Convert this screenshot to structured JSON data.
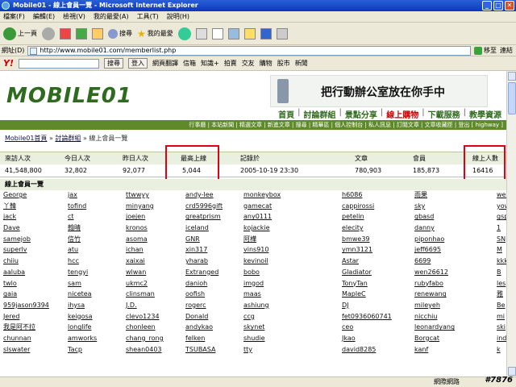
{
  "window": {
    "title": "Mobile01 - 線上會員一覽 - Microsoft Internet Explorer"
  },
  "menu": [
    "檔案(F)",
    "編輯(E)",
    "檢視(V)",
    "我的最愛(A)",
    "工具(T)",
    "說明(H)"
  ],
  "toolbar": {
    "back": "上一頁",
    "search": "搜尋",
    "favorites": "我的最愛"
  },
  "address": {
    "label": "網址(D)",
    "url": "http://www.mobile01.com/memberlist.php",
    "go": "移至",
    "links": "連結"
  },
  "yahoo_bar": {
    "logo": "Y!",
    "search_btn": "搜尋",
    "login_btn": "登入",
    "items": [
      "網頁翻譯",
      "信箱",
      "知識+",
      "拍賣",
      "交友",
      "購物",
      "股市",
      "新聞"
    ]
  },
  "site": {
    "logo": "MOBILE01",
    "banner_text": "把行動辦公室放在你手中",
    "nav": [
      "首頁",
      "討論群組",
      "景點分享",
      "線上購物",
      "下載服務",
      "教學資源"
    ],
    "active_nav": "線上購物",
    "subnav": "行事曆 | 本站新聞 | 精選文章 | 新進文章 | 搜尋 | 精華區 | 個人控制台 | 私人訊息 | 訂閱文章 | 文章收藏匣 | 登出 [ highway ]",
    "breadcrumb": [
      "Mobile01首頁",
      "討論群組",
      "線上會員一覽"
    ]
  },
  "stats": {
    "headers": [
      "來訪人次",
      "今日人次",
      "昨日人次",
      "最高上線",
      "記錄於",
      "文章",
      "會員",
      "線上人數"
    ],
    "values": [
      "41,548,800",
      "32,802",
      "92,077",
      "5,044",
      "2005-10-19 23:30",
      "780,903",
      "185,873",
      "16416"
    ]
  },
  "section_title": "線上會員一覽",
  "members": [
    [
      "George",
      "jax",
      "ttwwyy",
      "andy-lee",
      "monkeybox",
      "h6086",
      "雨果",
      "wer"
    ],
    [
      "丫韓",
      "tofind",
      "minyang",
      "crd5996gift",
      "gamecat",
      "cappirossi",
      "sky",
      "yow"
    ],
    [
      "jack",
      "ct",
      "joejen",
      "greatprism",
      "any0111",
      "petelin",
      "gbasd",
      "gsp"
    ],
    [
      "Dave",
      "翰晴",
      "kronos",
      "iceland",
      "kojackie",
      "elecity",
      "danny",
      "1"
    ],
    [
      "samejob",
      "信竹",
      "asoma",
      "GNR",
      "阿樺",
      "bmwe39",
      "piponhao",
      "SN"
    ],
    [
      "superlv",
      "atu",
      "ichan",
      "xin317",
      "vins910",
      "ymn3121",
      "jeff6695",
      "M"
    ],
    [
      "chiiu",
      "hcc",
      "xaixai",
      "yharab",
      "kevinoil",
      "Astar",
      "6699",
      "kkk"
    ],
    [
      "aaluba",
      "tengyi",
      "wlwan",
      "Extranged",
      "bobo",
      "Gladiator",
      "wen26612",
      "B"
    ],
    [
      "twlo",
      "sam",
      "ukmc2",
      "danioh",
      "imgod",
      "TonyTan",
      "rubyfabo",
      "les"
    ],
    [
      "gaia",
      "nicetea",
      "clinsman",
      "oofish",
      "maas",
      "MapleC",
      "renewang",
      "雅"
    ],
    [
      "959jason9394",
      "ihysa",
      "J.D.",
      "rogerc",
      "ashiung",
      "DJ",
      "mileyeh",
      "Be"
    ],
    [
      "Jered",
      "keigosa",
      "clevo1234",
      "Donald",
      "ccg",
      "fet0936060741",
      "nicchiu",
      "mi"
    ],
    [
      "我是阿不拉",
      "longlife",
      "chonleen",
      "andykao",
      "skynet",
      "ceo",
      "leonardyang",
      "ski"
    ],
    [
      "chunnan",
      "amworks",
      "chang_rong",
      "felken",
      "shudie",
      "Jkao",
      "Borgcat",
      "ind"
    ],
    [
      "slswater",
      "Tacp",
      "shean0403",
      "TSUBASA",
      "tty",
      "david8285",
      "kanf",
      "k"
    ]
  ],
  "status": {
    "zone": "網際網路",
    "watermark": "#7876"
  }
}
